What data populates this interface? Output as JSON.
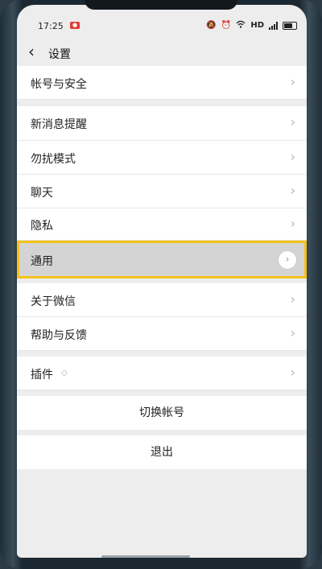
{
  "status_bar": {
    "time": "17:25",
    "network": "HD",
    "icons": [
      "alarm-icon",
      "clock-icon",
      "wifi-icon",
      "signal-icon",
      "battery-icon"
    ]
  },
  "header": {
    "title": "设置",
    "back_icon": "chevron-left-icon"
  },
  "groups": [
    {
      "items": [
        {
          "label": "帐号与安全"
        }
      ]
    },
    {
      "items": [
        {
          "label": "新消息提醒"
        },
        {
          "label": "勿扰模式"
        },
        {
          "label": "聊天"
        },
        {
          "label": "隐私"
        },
        {
          "label": "通用",
          "highlighted": true
        },
        {
          "label": "关于微信"
        },
        {
          "label": "帮助与反馈"
        }
      ]
    },
    {
      "items": [
        {
          "label": "插件",
          "icon": "plugin-icon"
        }
      ]
    }
  ],
  "buttons": {
    "switch_account": "切换帐号",
    "logout": "退出"
  },
  "colors": {
    "highlight_border": "#f5c21b",
    "background": "#ededed"
  }
}
